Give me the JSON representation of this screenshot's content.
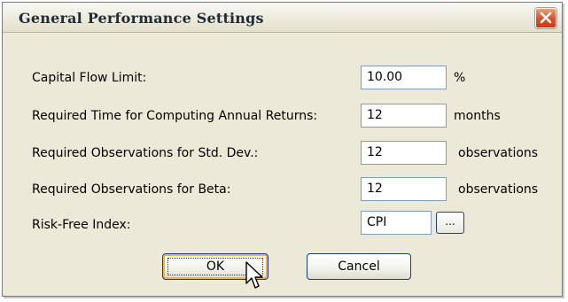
{
  "window": {
    "title": "General Performance Settings"
  },
  "rows": [
    {
      "label": "Capital Flow Limit:",
      "value": "10.00",
      "unit": "%"
    },
    {
      "label": "Required Time for Computing Annual Returns:",
      "value": "12",
      "unit": "months"
    },
    {
      "label": "Required Observations for Std. Dev.:",
      "value": "12",
      "unit": "observations"
    },
    {
      "label": "Required Observations for Beta:",
      "value": "12",
      "unit": "observations"
    },
    {
      "label": "Risk-Free Index:",
      "value": "CPI",
      "unit": ""
    }
  ],
  "buttons": {
    "browse": "...",
    "ok": "OK",
    "cancel": "Cancel"
  },
  "icons": {
    "close": "close-icon",
    "cursor": "mouse-pointer-icon"
  },
  "colors": {
    "dialog_bg": "#ece9d8",
    "close_button": "#d7562e",
    "button_border": "#1e3a8a"
  }
}
